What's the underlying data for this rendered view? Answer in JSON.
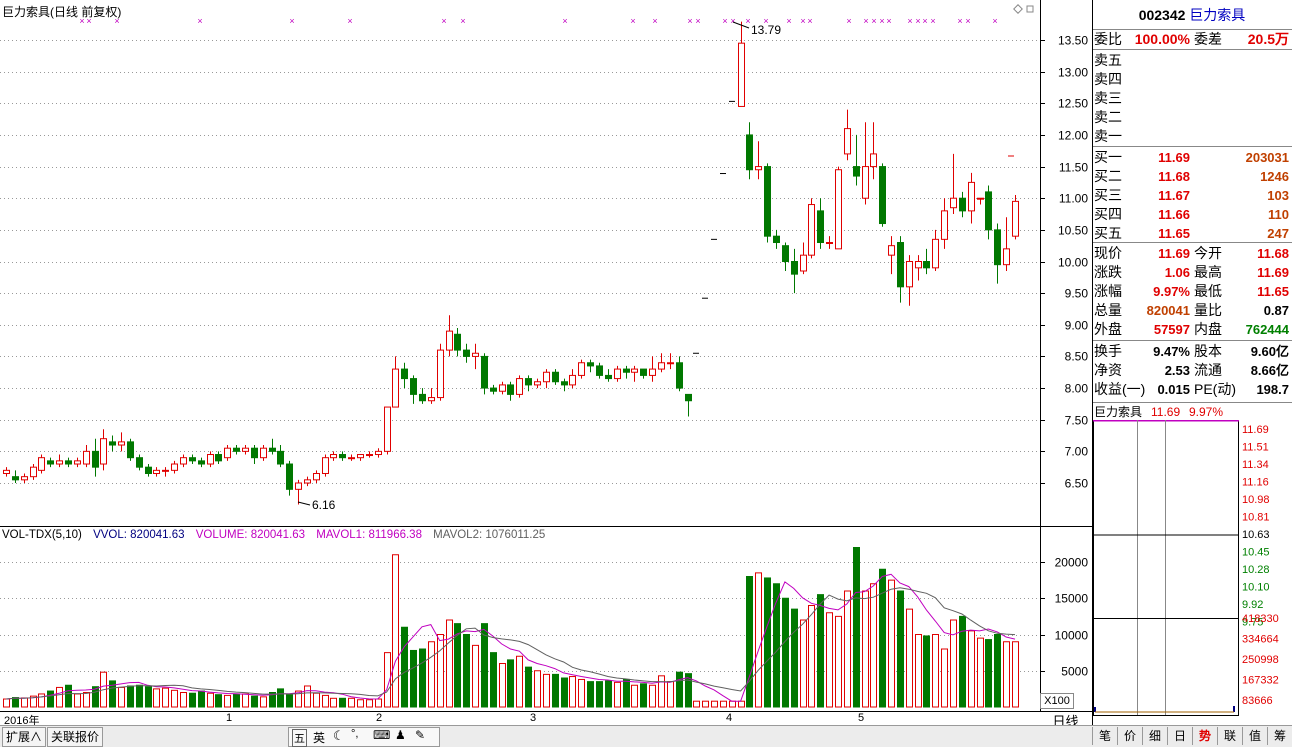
{
  "chart": {
    "title": "巨力索具(日线 前复权)",
    "high_label": "13.79",
    "low_label": "6.16",
    "price_ticks": [
      "13.50",
      "13.00",
      "12.50",
      "12.00",
      "11.50",
      "11.00",
      "10.50",
      "10.00",
      "9.50",
      "9.00",
      "8.50",
      "8.00",
      "7.50",
      "7.00",
      "6.50"
    ],
    "vol_ticks": [
      "20000",
      "15000",
      "10000",
      "5000"
    ],
    "vol_unit": "X100",
    "period": "日线",
    "dates": [
      "2016年",
      "1",
      "2",
      "3",
      "4",
      "5"
    ]
  },
  "vol_legend": {
    "label": "VOL-TDX(5,10)",
    "vvol": "VVOL: 820041.63",
    "volume": "VOLUME: 820041.63",
    "mavol1": "MAVOL1: 811966.38",
    "mavol2": "MAVOL2: 1076011.25"
  },
  "quote": {
    "code": "002342",
    "name": "巨力索具",
    "weibi_label": "委比",
    "weibi": "100.00%",
    "weicha_label": "委差",
    "weicha": "20.5万",
    "sells": [
      {
        "label": "卖五"
      },
      {
        "label": "卖四"
      },
      {
        "label": "卖三"
      },
      {
        "label": "卖二"
      },
      {
        "label": "卖一"
      }
    ],
    "buys": [
      {
        "label": "买一",
        "price": "11.69",
        "vol": "203031"
      },
      {
        "label": "买二",
        "price": "11.68",
        "vol": "1246"
      },
      {
        "label": "买三",
        "price": "11.67",
        "vol": "103"
      },
      {
        "label": "买四",
        "price": "11.66",
        "vol": "110"
      },
      {
        "label": "买五",
        "price": "11.65",
        "vol": "247"
      }
    ],
    "stats": [
      {
        "l1": "现价",
        "v1": "11.69",
        "l2": "今开",
        "v2": "11.68"
      },
      {
        "l1": "涨跌",
        "v1": "1.06",
        "l2": "最高",
        "v2": "11.69"
      },
      {
        "l1": "涨幅",
        "v1": "9.97%",
        "l2": "最低",
        "v2": "11.65"
      },
      {
        "l1": "总量",
        "v1": "820041",
        "l2": "量比",
        "v2": "0.87"
      },
      {
        "l1": "外盘",
        "v1": "57597",
        "l2": "内盘",
        "v2": "762444"
      },
      {
        "l1": "换手",
        "v1": "9.47%",
        "l2": "股本",
        "v2": "9.60亿"
      },
      {
        "l1": "净资",
        "v1": "2.53",
        "l2": "流通",
        "v2": "8.66亿"
      },
      {
        "l1": "收益(一)",
        "v1": "0.015",
        "l2": "PE(动)",
        "v2": "198.7"
      }
    ],
    "mini_title": "巨力索具",
    "mini_price": "11.69",
    "mini_pct": "9.97%",
    "mini_ticks_red": [
      "11.69",
      "11.51",
      "11.34",
      "11.16",
      "10.98",
      "10.81"
    ],
    "mini_tick_mid": "10.63",
    "mini_ticks_green": [
      "10.45",
      "10.28",
      "10.10",
      "9.92",
      "9.75"
    ],
    "mini_vol_ticks": [
      "418330",
      "334664",
      "250998",
      "167332",
      "83666"
    ]
  },
  "bottom": {
    "left_buttons": [
      "扩展∧",
      "关联报价"
    ],
    "ime": [
      "五",
      "英"
    ],
    "right_tabs": [
      "笔",
      "价",
      "细",
      "日",
      "势",
      "联",
      "值",
      "筹"
    ]
  },
  "chart_data": {
    "type": "candlestick",
    "ylim": [
      6.0,
      14.0
    ],
    "ohlc_note": "daily K-line, 2016",
    "candles": [
      [
        6.65,
        6.7,
        6.6,
        6.75
      ],
      [
        6.6,
        6.55,
        6.5,
        6.7
      ],
      [
        6.55,
        6.6,
        6.5,
        6.65
      ],
      [
        6.6,
        6.75,
        6.55,
        6.8
      ],
      [
        6.7,
        6.9,
        6.65,
        6.95
      ],
      [
        6.85,
        6.8,
        6.75,
        6.9
      ],
      [
        6.8,
        6.85,
        6.75,
        6.95
      ],
      [
        6.85,
        6.8,
        6.75,
        6.9
      ],
      [
        6.8,
        6.85,
        6.75,
        6.9
      ],
      [
        6.8,
        7.0,
        6.75,
        7.1
      ],
      [
        7.0,
        6.75,
        6.6,
        7.2
      ],
      [
        6.8,
        7.2,
        6.7,
        7.35
      ],
      [
        7.15,
        7.1,
        7.0,
        7.25
      ],
      [
        7.1,
        7.15,
        7.0,
        7.3
      ],
      [
        7.15,
        6.9,
        6.85,
        7.2
      ],
      [
        6.9,
        6.75,
        6.7,
        6.95
      ],
      [
        6.75,
        6.65,
        6.6,
        6.8
      ],
      [
        6.65,
        6.7,
        6.6,
        6.75
      ],
      [
        6.7,
        6.7,
        6.6,
        6.75
      ],
      [
        6.7,
        6.8,
        6.65,
        6.85
      ],
      [
        6.8,
        6.9,
        6.75,
        6.95
      ],
      [
        6.9,
        6.85,
        6.8,
        6.95
      ],
      [
        6.85,
        6.8,
        6.75,
        6.9
      ],
      [
        6.8,
        6.95,
        6.75,
        7.0
      ],
      [
        6.95,
        6.85,
        6.8,
        7.0
      ],
      [
        6.9,
        7.05,
        6.85,
        7.1
      ],
      [
        7.05,
        7.0,
        6.95,
        7.1
      ],
      [
        7.0,
        7.05,
        6.95,
        7.1
      ],
      [
        7.05,
        6.9,
        6.8,
        7.1
      ],
      [
        6.9,
        7.05,
        6.85,
        7.1
      ],
      [
        7.05,
        7.0,
        6.95,
        7.2
      ],
      [
        7.0,
        6.8,
        6.75,
        7.1
      ],
      [
        6.8,
        6.4,
        6.3,
        6.85
      ],
      [
        6.4,
        6.5,
        6.16,
        6.55
      ],
      [
        6.5,
        6.55,
        6.45,
        6.6
      ],
      [
        6.55,
        6.65,
        6.5,
        6.7
      ],
      [
        6.65,
        6.9,
        6.6,
        6.95
      ],
      [
        6.9,
        6.95,
        6.85,
        7.0
      ],
      [
        6.95,
        6.9,
        6.85,
        7.0
      ],
      [
        6.9,
        6.9,
        6.85,
        6.95
      ],
      [
        6.9,
        6.95,
        6.85,
        6.95
      ],
      [
        6.95,
        6.95,
        6.9,
        7.0
      ],
      [
        6.95,
        7.0,
        6.9,
        7.05
      ],
      [
        7.0,
        7.7,
        6.95,
        7.7
      ],
      [
        7.7,
        8.3,
        7.7,
        8.5
      ],
      [
        8.3,
        8.15,
        8.0,
        8.4
      ],
      [
        8.15,
        7.9,
        7.75,
        8.2
      ],
      [
        7.9,
        7.8,
        7.75,
        8.0
      ],
      [
        7.8,
        7.85,
        7.75,
        8.0
      ],
      [
        7.85,
        8.6,
        7.8,
        8.7
      ],
      [
        8.6,
        8.9,
        8.5,
        9.15
      ],
      [
        8.85,
        8.6,
        8.5,
        8.95
      ],
      [
        8.6,
        8.5,
        8.4,
        8.7
      ],
      [
        8.5,
        8.55,
        8.3,
        8.7
      ],
      [
        8.5,
        8.0,
        7.9,
        8.55
      ],
      [
        8.0,
        7.95,
        7.9,
        8.05
      ],
      [
        7.95,
        8.05,
        7.9,
        8.1
      ],
      [
        8.05,
        7.9,
        7.8,
        8.1
      ],
      [
        7.9,
        8.15,
        7.85,
        8.2
      ],
      [
        8.15,
        8.05,
        7.95,
        8.2
      ],
      [
        8.05,
        8.1,
        8.0,
        8.15
      ],
      [
        8.1,
        8.25,
        8.0,
        8.3
      ],
      [
        8.25,
        8.1,
        8.05,
        8.3
      ],
      [
        8.1,
        8.05,
        7.95,
        8.15
      ],
      [
        8.05,
        8.2,
        8.0,
        8.3
      ],
      [
        8.2,
        8.4,
        8.15,
        8.45
      ],
      [
        8.4,
        8.35,
        8.25,
        8.45
      ],
      [
        8.35,
        8.2,
        8.15,
        8.4
      ],
      [
        8.2,
        8.15,
        8.1,
        8.3
      ],
      [
        8.15,
        8.3,
        8.1,
        8.35
      ],
      [
        8.3,
        8.25,
        8.15,
        8.35
      ],
      [
        8.25,
        8.3,
        8.1,
        8.35
      ],
      [
        8.3,
        8.2,
        8.15,
        8.3
      ],
      [
        8.2,
        8.3,
        8.1,
        8.5
      ],
      [
        8.3,
        8.4,
        8.25,
        8.55
      ],
      [
        8.4,
        8.4,
        8.3,
        8.55
      ],
      [
        8.4,
        8.0,
        7.95,
        8.5
      ],
      [
        7.9,
        7.8,
        7.55,
        7.9
      ],
      [
        8.55,
        8.55,
        8.55,
        8.55
      ],
      [
        9.42,
        9.42,
        9.42,
        9.42
      ],
      [
        10.35,
        10.35,
        10.35,
        10.35
      ],
      [
        11.39,
        11.39,
        11.39,
        11.39
      ],
      [
        12.53,
        12.53,
        12.53,
        12.53
      ],
      [
        12.45,
        13.45,
        12.45,
        13.79
      ],
      [
        12.0,
        11.45,
        11.3,
        12.2
      ],
      [
        11.45,
        11.5,
        11.3,
        11.9
      ],
      [
        11.5,
        10.4,
        10.3,
        11.55
      ],
      [
        10.4,
        10.3,
        10.2,
        10.5
      ],
      [
        10.25,
        10.0,
        9.85,
        10.3
      ],
      [
        10.0,
        9.8,
        9.5,
        10.2
      ],
      [
        9.85,
        10.1,
        9.8,
        10.3
      ],
      [
        10.1,
        10.9,
        10.05,
        11.0
      ],
      [
        10.8,
        10.3,
        10.2,
        11.0
      ],
      [
        10.3,
        10.3,
        10.2,
        10.4
      ],
      [
        10.2,
        11.45,
        10.2,
        11.5
      ],
      [
        11.7,
        12.1,
        11.6,
        12.4
      ],
      [
        11.5,
        11.35,
        11.2,
        12.0
      ],
      [
        11.0,
        11.5,
        10.9,
        12.2
      ],
      [
        11.5,
        11.7,
        11.3,
        12.2
      ],
      [
        11.5,
        10.6,
        10.55,
        11.55
      ],
      [
        10.1,
        10.25,
        9.8,
        10.4
      ],
      [
        10.3,
        9.6,
        9.35,
        10.4
      ],
      [
        9.6,
        10.0,
        9.3,
        10.1
      ],
      [
        9.9,
        10.0,
        9.7,
        10.1
      ],
      [
        10.0,
        9.9,
        9.8,
        10.2
      ],
      [
        9.9,
        10.35,
        9.85,
        10.5
      ],
      [
        10.35,
        10.8,
        10.2,
        11.0
      ],
      [
        10.85,
        11.0,
        10.75,
        11.7
      ],
      [
        11.0,
        10.8,
        10.7,
        11.1
      ],
      [
        10.8,
        11.25,
        10.6,
        11.4
      ],
      [
        11.0,
        11.0,
        10.9,
        11.0
      ],
      [
        11.1,
        10.5,
        10.35,
        11.2
      ],
      [
        10.5,
        9.95,
        9.65,
        10.6
      ],
      [
        9.95,
        10.2,
        9.85,
        10.7
      ],
      [
        10.4,
        10.95,
        10.35,
        11.05
      ]
    ],
    "volumes": [
      1100,
      1300,
      1250,
      1500,
      1800,
      2200,
      2700,
      3000,
      1800,
      2000,
      2800,
      4800,
      3600,
      2700,
      2900,
      3000,
      2800,
      2500,
      2600,
      2300,
      2000,
      1900,
      2200,
      1900,
      1700,
      1600,
      1800,
      1800,
      1500,
      1400,
      2000,
      2500,
      1700,
      2200,
      2900,
      1900,
      1600,
      1200,
      1200,
      1200,
      1000,
      1000,
      1100,
      7500,
      21000,
      11000,
      7800,
      8000,
      9000,
      10000,
      12000,
      11500,
      10000,
      8500,
      11500,
      7500,
      6000,
      6500,
      7000,
      5500,
      5000,
      4500,
      4500,
      4000,
      4200,
      3800,
      3500,
      3500,
      3600,
      3400,
      3800,
      3000,
      3200,
      3000,
      4300,
      3500,
      4800,
      4600,
      800,
      800,
      800,
      800,
      800,
      800,
      18000,
      18500,
      17800,
      17000,
      15000,
      13500,
      12000,
      14000,
      15500,
      13000,
      12500,
      16000,
      22000,
      16000,
      17000,
      19000,
      17500,
      16000,
      13500,
      10000,
      9800,
      10000,
      8000,
      12000,
      12500,
      10500,
      9500,
      9300,
      10000,
      9000,
      9000,
      8000
    ],
    "mavol1_note": "magenta moving average",
    "mavol2_note": "gray moving average",
    "markers_row_count": 40
  }
}
